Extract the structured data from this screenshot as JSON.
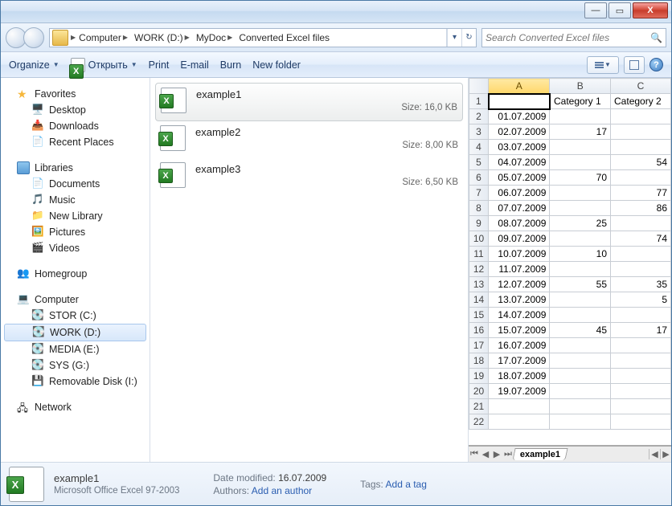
{
  "window_controls": {
    "min": "—",
    "max": "▭",
    "close": "X"
  },
  "breadcrumb": {
    "segments": [
      "Computer",
      "WORK (D:)",
      "MyDoc",
      "Converted Excel files"
    ]
  },
  "search": {
    "placeholder": "Search Converted Excel files"
  },
  "toolbar": {
    "organize": "Organize",
    "open": "Открыть",
    "print": "Print",
    "email": "E-mail",
    "burn": "Burn",
    "newfolder": "New folder"
  },
  "nav": {
    "favorites": {
      "label": "Favorites",
      "items": [
        "Desktop",
        "Downloads",
        "Recent Places"
      ]
    },
    "libraries": {
      "label": "Libraries",
      "items": [
        "Documents",
        "Music",
        "New Library",
        "Pictures",
        "Videos"
      ]
    },
    "homegroup": {
      "label": "Homegroup"
    },
    "computer": {
      "label": "Computer",
      "items": [
        "STOR (C:)",
        "WORK (D:)",
        "MEDIA (E:)",
        "SYS (G:)",
        "Removable Disk (I:)"
      ],
      "selected": "WORK (D:)"
    },
    "network": {
      "label": "Network"
    }
  },
  "files": {
    "size_prefix": "Size: ",
    "items": [
      {
        "name": "example1",
        "size": "16,0 KB",
        "selected": true
      },
      {
        "name": "example2",
        "size": "8,00 KB",
        "selected": false
      },
      {
        "name": "example3",
        "size": "6,50 KB",
        "selected": false
      }
    ]
  },
  "preview": {
    "columns": [
      "A",
      "B",
      "C"
    ],
    "header_row": [
      "",
      "Category 1",
      "Category 2"
    ],
    "rows": [
      {
        "n": 2,
        "date": "01.07.2009",
        "c1": "",
        "c2": ""
      },
      {
        "n": 3,
        "date": "02.07.2009",
        "c1": "17",
        "c2": ""
      },
      {
        "n": 4,
        "date": "03.07.2009",
        "c1": "",
        "c2": ""
      },
      {
        "n": 5,
        "date": "04.07.2009",
        "c1": "",
        "c2": "54"
      },
      {
        "n": 6,
        "date": "05.07.2009",
        "c1": "70",
        "c2": ""
      },
      {
        "n": 7,
        "date": "06.07.2009",
        "c1": "",
        "c2": "77"
      },
      {
        "n": 8,
        "date": "07.07.2009",
        "c1": "",
        "c2": "86"
      },
      {
        "n": 9,
        "date": "08.07.2009",
        "c1": "25",
        "c2": ""
      },
      {
        "n": 10,
        "date": "09.07.2009",
        "c1": "",
        "c2": "74"
      },
      {
        "n": 11,
        "date": "10.07.2009",
        "c1": "10",
        "c2": ""
      },
      {
        "n": 12,
        "date": "11.07.2009",
        "c1": "",
        "c2": ""
      },
      {
        "n": 13,
        "date": "12.07.2009",
        "c1": "55",
        "c2": "35"
      },
      {
        "n": 14,
        "date": "13.07.2009",
        "c1": "",
        "c2": "5"
      },
      {
        "n": 15,
        "date": "14.07.2009",
        "c1": "",
        "c2": ""
      },
      {
        "n": 16,
        "date": "15.07.2009",
        "c1": "45",
        "c2": "17"
      },
      {
        "n": 17,
        "date": "16.07.2009",
        "c1": "",
        "c2": ""
      },
      {
        "n": 18,
        "date": "17.07.2009",
        "c1": "",
        "c2": ""
      },
      {
        "n": 19,
        "date": "18.07.2009",
        "c1": "",
        "c2": ""
      },
      {
        "n": 20,
        "date": "19.07.2009",
        "c1": "",
        "c2": ""
      },
      {
        "n": 21,
        "date": "",
        "c1": "",
        "c2": ""
      },
      {
        "n": 22,
        "date": "",
        "c1": "",
        "c2": ""
      }
    ],
    "sheet_tab": "example1"
  },
  "details": {
    "name": "example1",
    "type": "Microsoft Office Excel 97-2003",
    "date_modified_label": "Date modified:",
    "date_modified": "16.07.2009",
    "authors_label": "Authors:",
    "authors": "Add an author",
    "tags_label": "Tags:",
    "tags": "Add a tag"
  }
}
